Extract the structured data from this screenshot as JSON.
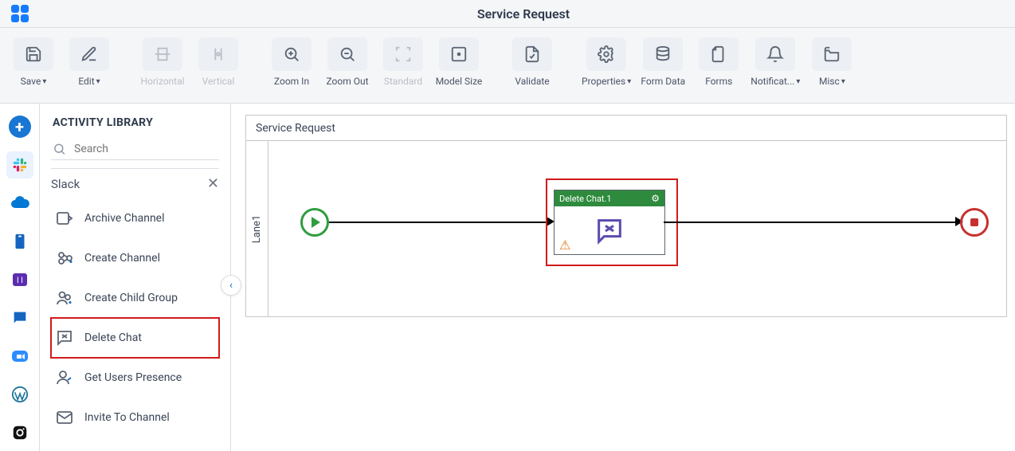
{
  "header": {
    "title": "Service Request"
  },
  "toolbar": {
    "save": "Save",
    "edit": "Edit",
    "horizontal": "Horizontal",
    "vertical": "Vertical",
    "zoom_in": "Zoom In",
    "zoom_out": "Zoom Out",
    "standard": "Standard",
    "model_size": "Model Size",
    "validate": "Validate",
    "properties": "Properties",
    "form_data": "Form Data",
    "forms": "Forms",
    "notifications": "Notificat...",
    "misc": "Misc"
  },
  "library": {
    "heading": "ACTIVITY LIBRARY",
    "search_placeholder": "Search",
    "section_title": "Slack",
    "items": [
      {
        "label": "Archive Channel"
      },
      {
        "label": "Create Channel"
      },
      {
        "label": "Create Child Group"
      },
      {
        "label": "Delete Chat"
      },
      {
        "label": "Get Users Presence"
      },
      {
        "label": "Invite To Channel"
      }
    ],
    "highlighted_index": 3
  },
  "canvas": {
    "process_title": "Service Request",
    "lane_label": "Lane1",
    "activity": {
      "title": "Delete Chat.1"
    }
  }
}
